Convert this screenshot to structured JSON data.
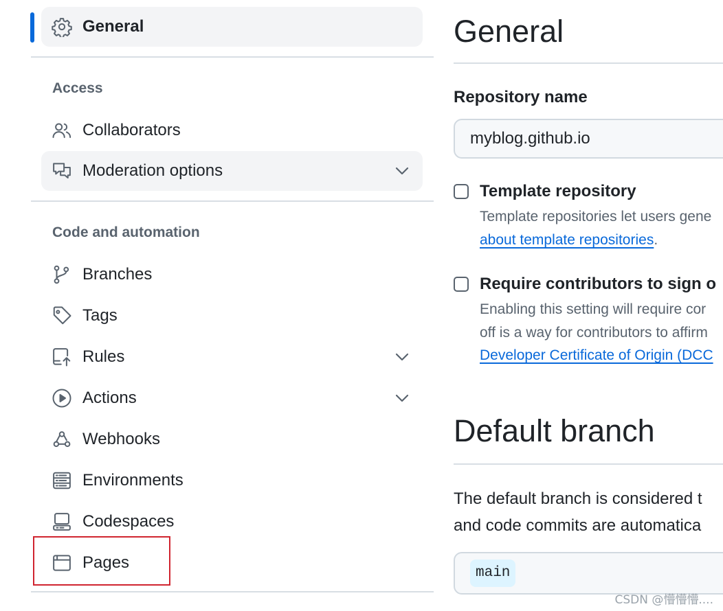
{
  "sidebar": {
    "general": {
      "label": "General",
      "icon": "gear-icon"
    },
    "access_heading": "Access",
    "collaborators": {
      "label": "Collaborators",
      "icon": "people-icon"
    },
    "moderation": {
      "label": "Moderation options",
      "icon": "comment-discussion-icon"
    },
    "code_heading": "Code and automation",
    "branches": {
      "label": "Branches",
      "icon": "git-branch-icon"
    },
    "tags": {
      "label": "Tags",
      "icon": "tag-icon"
    },
    "rules": {
      "label": "Rules",
      "icon": "repo-push-icon"
    },
    "actions": {
      "label": "Actions",
      "icon": "play-icon"
    },
    "webhooks": {
      "label": "Webhooks",
      "icon": "webhook-icon"
    },
    "environments": {
      "label": "Environments",
      "icon": "server-icon"
    },
    "codespaces": {
      "label": "Codespaces",
      "icon": "codespaces-icon"
    },
    "pages": {
      "label": "Pages",
      "icon": "browser-icon"
    }
  },
  "main": {
    "title": "General",
    "repo_name_label": "Repository name",
    "repo_name_value": "myblog.github.io",
    "template": {
      "title": "Template repository",
      "desc_line1": "Template repositories let users gene",
      "link": "about template repositories",
      "link_suffix": "."
    },
    "signoff": {
      "title": "Require contributors to sign o",
      "desc_line1": "Enabling this setting will require cor",
      "desc_line2": "off is a way for contributors to affirm",
      "link": "Developer Certificate of Origin (DCC"
    },
    "default_branch": {
      "title": "Default branch",
      "desc_line1": "The default branch is considered t",
      "desc_line2": "and code commits are automatica",
      "branch": "main"
    }
  },
  "watermark": "CSDN @懵懵懵...."
}
